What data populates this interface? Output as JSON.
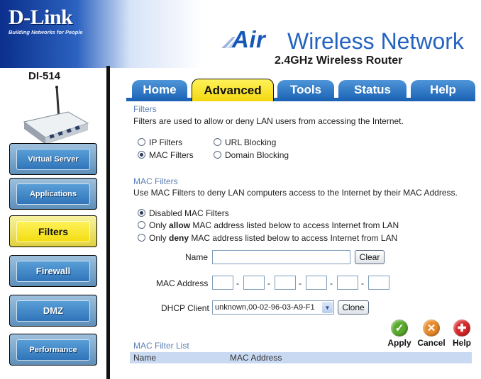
{
  "header": {
    "brand": "D-Link",
    "tagline": "Building Networks for People",
    "title_air": "Air",
    "title_rest": "Wireless Network",
    "subtitle": "2.4GHz Wireless Router"
  },
  "sidebar": {
    "model": "DI-514",
    "items": [
      {
        "label": "Virtual Server"
      },
      {
        "label": "Applications"
      },
      {
        "label": "Filters"
      },
      {
        "label": "Firewall"
      },
      {
        "label": "DMZ"
      },
      {
        "label": "Performance"
      }
    ]
  },
  "tabs": [
    {
      "label": "Home"
    },
    {
      "label": "Advanced"
    },
    {
      "label": "Tools"
    },
    {
      "label": "Status"
    },
    {
      "label": "Help"
    }
  ],
  "filters": {
    "title": "Filters",
    "description": "Filters are used to allow or deny LAN users from accessing the Internet.",
    "options": [
      "IP Filters",
      "URL Blocking",
      "MAC Filters",
      "Domain Blocking"
    ]
  },
  "mac_filters": {
    "title": "MAC Filters",
    "description": "Use MAC Filters to deny LAN computers access to the Internet by their MAC Address.",
    "opt_disabled": "Disabled MAC Filters",
    "opt_allow_pre": "Only",
    "opt_allow_kw": "allow",
    "opt_allow_post": "MAC address listed below to access Internet from LAN",
    "opt_deny_pre": "Only",
    "opt_deny_kw": "deny",
    "opt_deny_post": "MAC address listed below to access Internet from LAN",
    "name_label": "Name",
    "name_value": "",
    "clear_label": "Clear",
    "mac_label": "MAC Address",
    "mac_separator": "-",
    "dhcp_label": "DHCP Client",
    "dhcp_selected": "unknown,00-02-96-03-A9-F1",
    "clone_label": "Clone"
  },
  "actions": {
    "apply": "Apply",
    "cancel": "Cancel",
    "help": "Help"
  },
  "list": {
    "title": "MAC Filter List",
    "columns": [
      "Name",
      "MAC Address"
    ]
  },
  "colors": {
    "apply": "#5aa92e",
    "cancel": "#e8892a",
    "help": "#d8262a",
    "tab_active": "#f3d710",
    "tab": "#1d64b6"
  }
}
